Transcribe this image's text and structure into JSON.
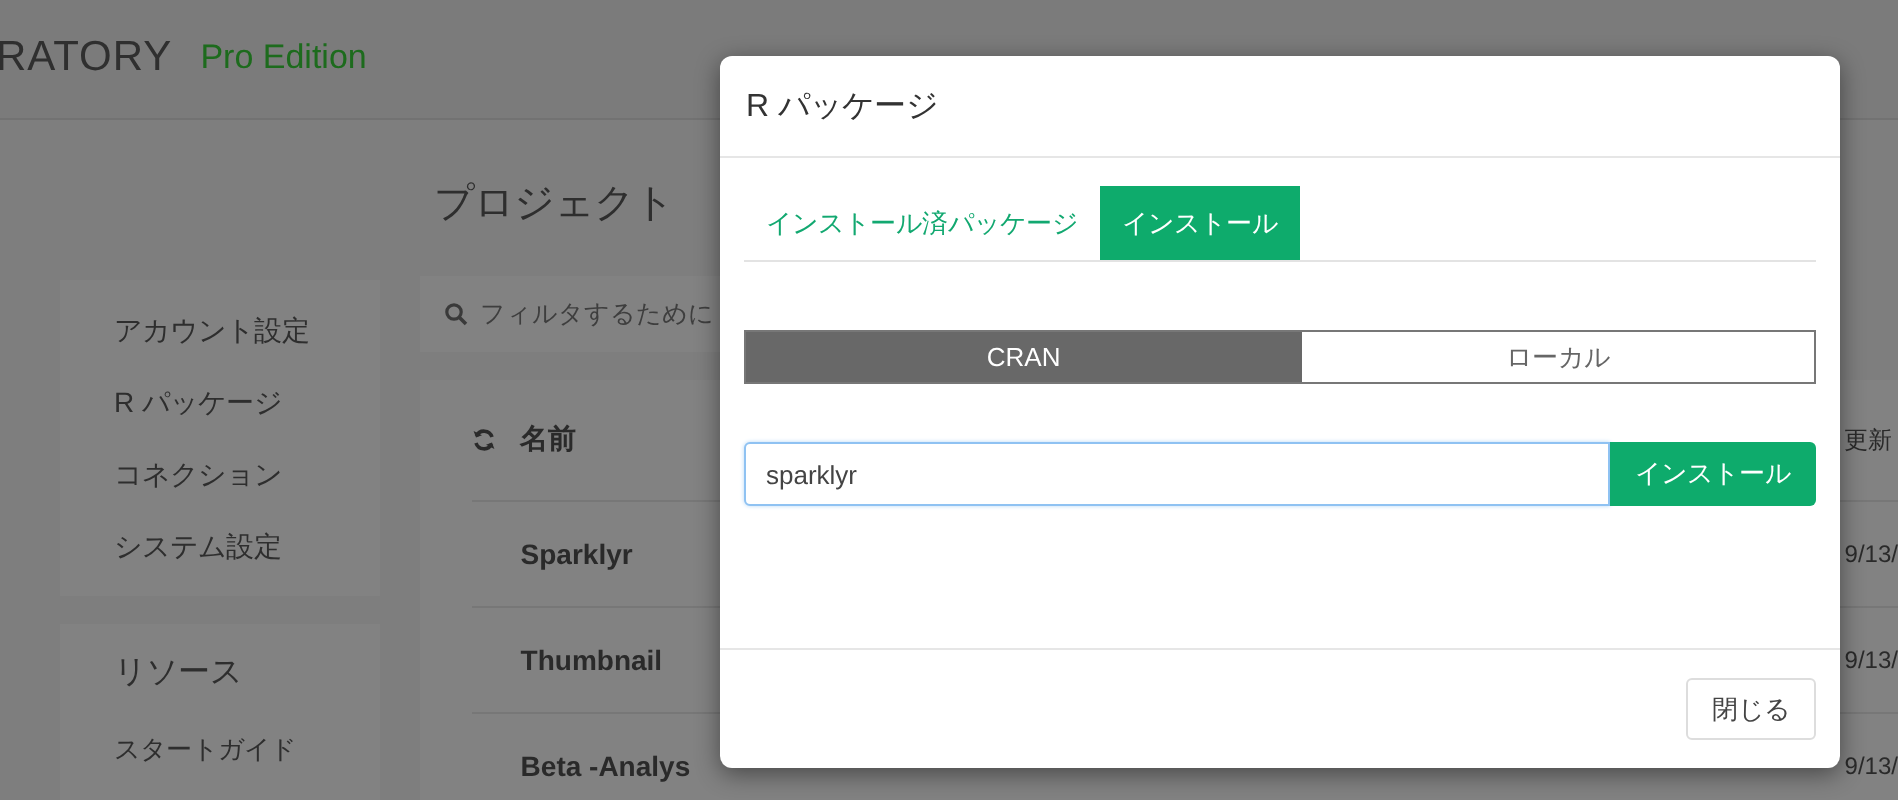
{
  "app_header": {
    "logo_text": "RATORY",
    "edition": "Pro Edition"
  },
  "page_title": "プロジェクト",
  "sidebar": {
    "sections": [
      {
        "items": [
          "アカウント設定",
          "R パッケージ",
          "コネクション",
          "システム設定"
        ]
      },
      {
        "title": "リソース",
        "items": [
          "スタートガイド"
        ]
      }
    ]
  },
  "filter": {
    "placeholder": "フィルタするために"
  },
  "table": {
    "columns": [
      "名前",
      "更新"
    ],
    "rows": [
      {
        "name": "Sparklyr",
        "updated": "9/13/"
      },
      {
        "name": "Thumbnail",
        "updated": "9/13/"
      },
      {
        "name": "Beta -Analys",
        "updated": "9/13/"
      }
    ]
  },
  "dialog": {
    "title": "R パッケージ",
    "tabs": [
      {
        "label": "インストール済パッケージ",
        "selected": false
      },
      {
        "label": "インストール",
        "selected": true
      }
    ],
    "sources": [
      {
        "label": "CRAN",
        "selected": true
      },
      {
        "label": "ローカル",
        "selected": false
      }
    ],
    "package_field": {
      "value": "sparklyr"
    },
    "install_button": "インストール",
    "close_button": "閉じる"
  }
}
